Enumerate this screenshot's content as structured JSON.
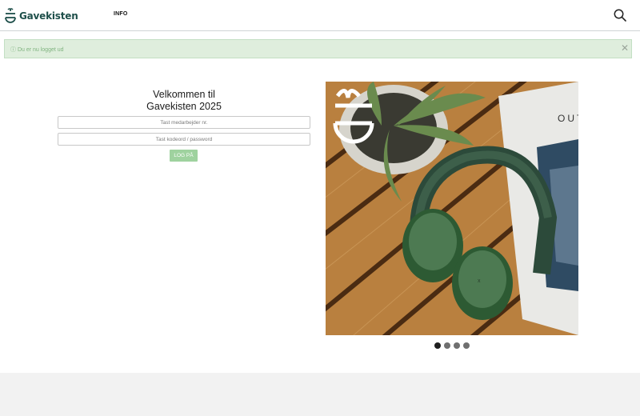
{
  "header": {
    "brand_name": "Gavekisten",
    "nav_info": "INFO",
    "search_icon": "search-icon",
    "brand_color": "#1e4f4a"
  },
  "alert": {
    "icon": "info-icon",
    "message": "ⓘ Du er nu logget ud",
    "close": "✕",
    "background": "#dfeedd"
  },
  "login": {
    "welcome_line1": "Velkommen til",
    "welcome_line2": "Gavekisten 2025",
    "employee_placeholder": "Tast medarbejder nr.",
    "password_placeholder": "Tast kodeord / password",
    "login_label": "LOG PÅ",
    "button_color": "#9fd29f"
  },
  "carousel": {
    "image": "green-headphones-on-wooden-table",
    "magazine_text": "OUT",
    "slides": 4,
    "active_slide": 1
  }
}
